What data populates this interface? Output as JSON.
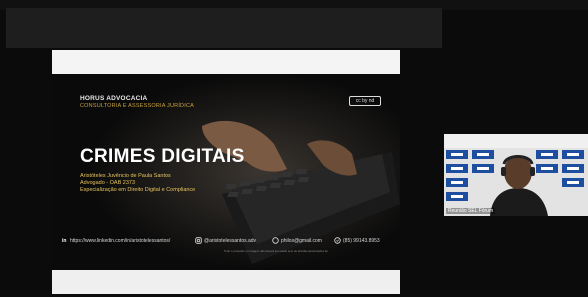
{
  "slide": {
    "firm_name": "HORUS ADVOCACIA",
    "firm_subtitle": "CONSULTORIA E ASSESSORIA JURÍDICA",
    "license_badge": "cc by nd",
    "title": "CRIMES DIGITAIS",
    "presenter_line1": "Aristóteles Juvêncio de Paula Santos",
    "presenter_line2": "Advogado - OAB 2373",
    "presenter_line3": "Especialização em Direito Digital e Compliance",
    "contacts": {
      "linkedin_icon": "in",
      "linkedin": "https://www.linkedin.com/in/aristotelessantos/",
      "instagram": "@aristotelessantos.adv",
      "email": "philos@gmail.com",
      "phone": "(85) 99143.8953"
    },
    "disclaimer": "Todo o conteúdo ou imagem não deverá ser usado sem as devidas autorizações de"
  },
  "participant": {
    "name_label": "Reunião SEL Fórum"
  },
  "icons": {
    "linkedin": "linkedin-icon",
    "instagram": "instagram-icon",
    "email": "email-icon",
    "phone": "whatsapp-icon",
    "license": "creative-commons-icon"
  },
  "colors": {
    "accent_gold": "#e6c35c",
    "background": "#0b0b0b",
    "title": "#ffffff"
  }
}
